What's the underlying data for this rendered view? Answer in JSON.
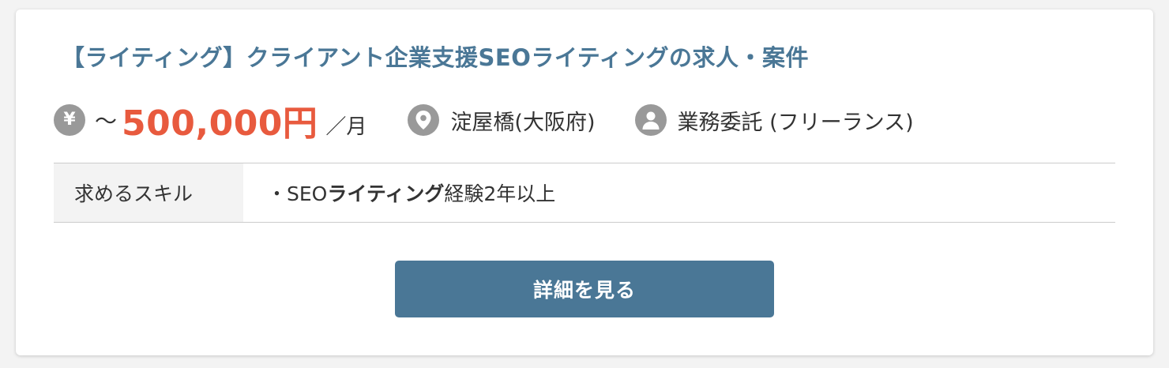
{
  "job": {
    "title": "【ライティング】クライアント企業支援SEOライティングの求人・案件",
    "salary": {
      "icon": "yen-icon",
      "icon_glyph": "¥",
      "prefix": "～",
      "amount": "500,000円",
      "unit": "／月"
    },
    "location": {
      "icon": "location-pin-icon",
      "text": "淀屋橋(大阪府)"
    },
    "employment": {
      "icon": "person-icon",
      "text": "業務委託 (フリーランス)"
    },
    "skills": {
      "label": "求めるスキル",
      "value_prefix": "・SEO",
      "value_bold": "ライティング",
      "value_suffix": "経験2年以上"
    },
    "detail_button_label": "詳細を見る"
  },
  "colors": {
    "accent": "#4a7796",
    "salary": "#e85a3e",
    "icon_gray": "#999999",
    "table_head_bg": "#f3f3f3"
  }
}
